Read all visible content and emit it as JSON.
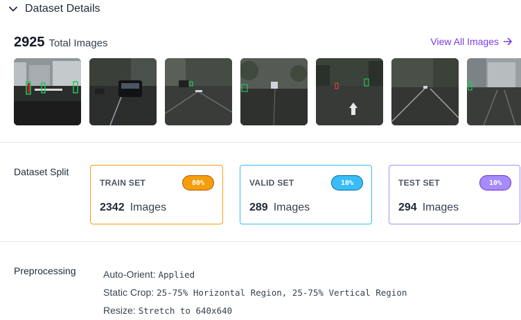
{
  "header": {
    "title": "Dataset Details",
    "icon": "chevron-down-icon"
  },
  "summary": {
    "count": "2925",
    "label": "Total Images",
    "view_all": "View All Images"
  },
  "thumbnails": [
    {
      "name": "street-image-1"
    },
    {
      "name": "street-image-2"
    },
    {
      "name": "street-image-3"
    },
    {
      "name": "street-image-4"
    },
    {
      "name": "street-image-5"
    },
    {
      "name": "street-image-6"
    },
    {
      "name": "street-image-7"
    }
  ],
  "split": {
    "label": "Dataset Split",
    "cards": [
      {
        "title": "TRAIN SET",
        "badge": "80%",
        "count": "2342",
        "unit": "Images",
        "color": "#f59e0b"
      },
      {
        "title": "VALID SET",
        "badge": "10%",
        "count": "289",
        "unit": "Images",
        "color": "#38bdf8"
      },
      {
        "title": "TEST SET",
        "badge": "10%",
        "count": "294",
        "unit": "Images",
        "color": "#a78bfa"
      }
    ]
  },
  "preprocessing": {
    "label": "Preprocessing",
    "items": [
      {
        "key": "Auto-Orient:",
        "value": "Applied"
      },
      {
        "key": "Static Crop:",
        "value": "25-75% Horizontal Region, 25-75% Vertical Region"
      },
      {
        "key": "Resize:",
        "value": "Stretch to 640x640"
      }
    ]
  }
}
